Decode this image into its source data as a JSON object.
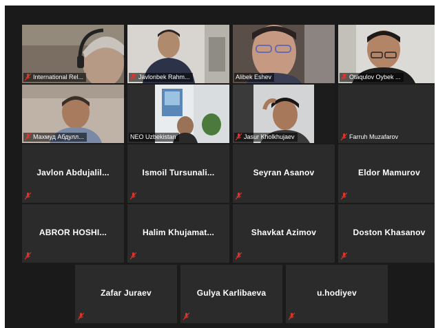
{
  "meeting": {
    "participants": [
      {
        "name": "International Rel...",
        "video": true,
        "muted": true
      },
      {
        "name": "Javlonbek Rahm...",
        "video": true,
        "muted": true
      },
      {
        "name": "Alibek Eshev",
        "video": true,
        "muted": false,
        "active_speaker": true
      },
      {
        "name": "Otaqulov Oybek ...",
        "video": true,
        "muted": true
      },
      {
        "name": "Махмуд Абдулл...",
        "video": true,
        "muted": true
      },
      {
        "name": "NEO Uzbekistan",
        "video": true,
        "muted": false
      },
      {
        "name": "Jasur Kholkhujaev",
        "video": true,
        "muted": true
      },
      {
        "name": "Farruh Muzafarov",
        "video": false,
        "muted": true
      },
      {
        "name": "Javlon Abdujalil...",
        "video": false,
        "muted": true
      },
      {
        "name": "Ismoil Tursunali...",
        "video": false,
        "muted": true
      },
      {
        "name": "Seyran Asanov",
        "video": false,
        "muted": true
      },
      {
        "name": "Eldor Mamurov",
        "video": false,
        "muted": true
      },
      {
        "name": "ABROR HOSHI...",
        "video": false,
        "muted": true
      },
      {
        "name": "Halim Khujamat...",
        "video": false,
        "muted": true
      },
      {
        "name": "Shavkat Azimov",
        "video": false,
        "muted": true
      },
      {
        "name": "Doston Khasanov",
        "video": false,
        "muted": true
      },
      {
        "name": "Zafar Juraev",
        "video": false,
        "muted": true
      },
      {
        "name": "Gulya Karlibaeva",
        "video": false,
        "muted": true
      },
      {
        "name": "u.hodiyev",
        "video": false,
        "muted": true
      }
    ],
    "colors": {
      "background": "#1a1a1a",
      "tile": "#2b2b2b",
      "active_outline": "#c9e26a",
      "mute": "#e0342b"
    },
    "icons": {
      "mute": "muted-microphone-icon"
    }
  }
}
